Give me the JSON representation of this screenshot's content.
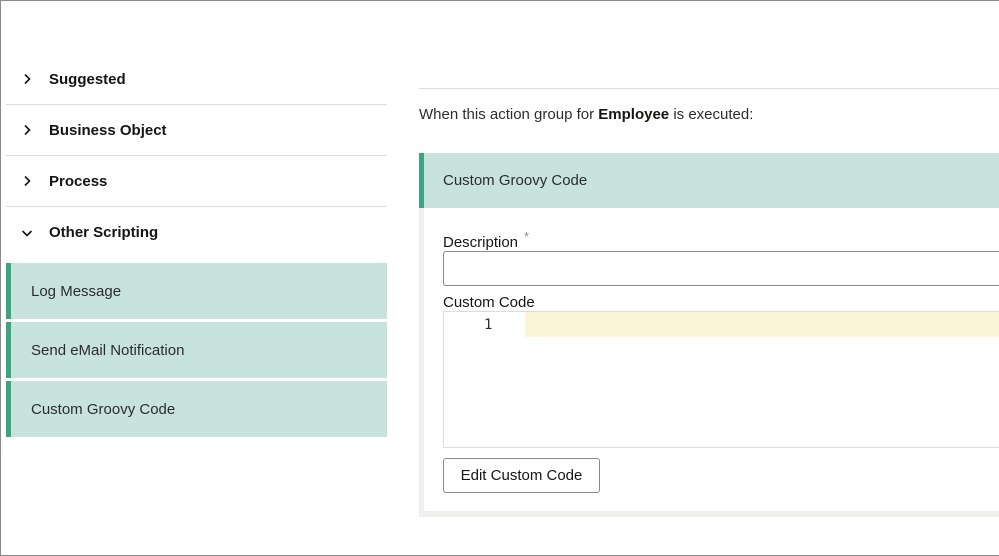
{
  "accordion": {
    "sections": [
      {
        "label": "Suggested",
        "expanded": false
      },
      {
        "label": "Business Object",
        "expanded": false
      },
      {
        "label": "Process",
        "expanded": false
      },
      {
        "label": "Other Scripting",
        "expanded": true
      }
    ],
    "other_scripting_items": [
      {
        "label": "Log Message"
      },
      {
        "label": "Send eMail Notification"
      },
      {
        "label": "Custom Groovy Code"
      }
    ]
  },
  "main": {
    "intro_prefix": "When this action group for",
    "intro_object": "Employee",
    "intro_suffix": "is executed:",
    "card": {
      "title": "Custom Groovy Code",
      "description_label": "Description",
      "required_marker": "*",
      "description_value": "",
      "custom_code_label": "Custom Code",
      "line_number": "1",
      "edit_button_label": "Edit Custom Code"
    }
  },
  "colors": {
    "accent": "#3aa57f",
    "selected_bg": "#c7e3dc",
    "active_line": "#fdf5d8"
  },
  "icons": {
    "collapsed": "chevron-right-icon",
    "expanded": "chevron-down-icon"
  }
}
